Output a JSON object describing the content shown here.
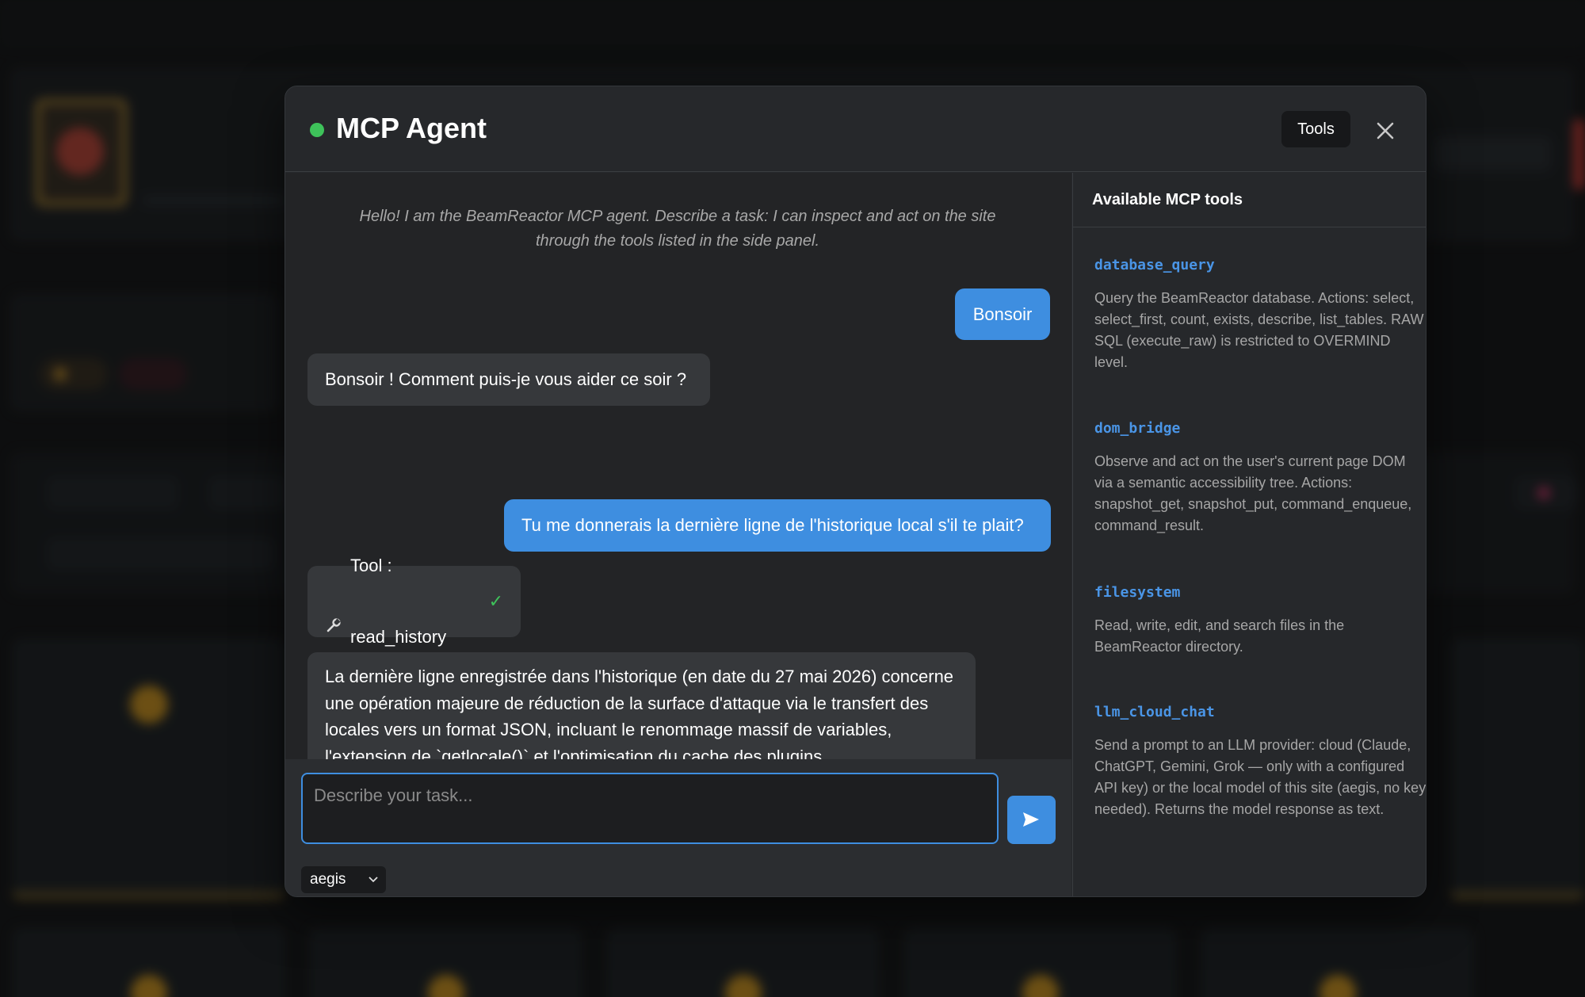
{
  "modal": {
    "title": "MCP Agent",
    "tools_button": "Tools",
    "status_color": "#3ec25a"
  },
  "chat": {
    "intro": "Hello! I am the BeamReactor MCP agent. Describe a task: I can inspect and act on the site through the tools listed in the side panel.",
    "messages": [
      {
        "role": "user",
        "text": "Bonsoir"
      },
      {
        "role": "assistant",
        "text": "Bonsoir ! Comment puis-je vous aider ce soir ?"
      },
      {
        "role": "user",
        "text": "Tu me donnerais la dernière ligne de l'historique local s'il te plait?"
      },
      {
        "role": "tool",
        "text": "Tool : read_history",
        "status": "✓"
      },
      {
        "role": "assistant",
        "text": "La dernière ligne enregistrée dans l'historique (en date du 27 mai 2026) concerne une opération majeure de réduction de la surface d'attaque via le transfert des locales vers un format JSON, incluant le renommage massif de variables, l'extension de `getlocale()` et l'optimisation du cache des plugins."
      }
    ],
    "input_placeholder": "Describe your task...",
    "model": "aegis"
  },
  "tools_panel": {
    "title": "Available MCP tools",
    "tools": [
      {
        "name": "database_query",
        "description": "Query the BeamReactor database. Actions: select, select_first, count, exists, describe, list_tables. RAW SQL (execute_raw) is restricted to OVERMIND level."
      },
      {
        "name": "dom_bridge",
        "description": "Observe and act on the user's current page DOM via a semantic accessibility tree. Actions: snapshot_get, snapshot_put, command_enqueue, command_result."
      },
      {
        "name": "filesystem",
        "description": "Read, write, edit, and search files in the BeamReactor directory."
      },
      {
        "name": "llm_cloud_chat",
        "description": "Send a prompt to an LLM provider: cloud (Claude, ChatGPT, Gemini, Grok — only with a configured API key) or the local model of this site (aegis, no key needed). Returns the model response as text."
      }
    ]
  },
  "colors": {
    "accent": "#3e8ee0",
    "tool_name": "#4a95e6",
    "success": "#3ec25a"
  }
}
